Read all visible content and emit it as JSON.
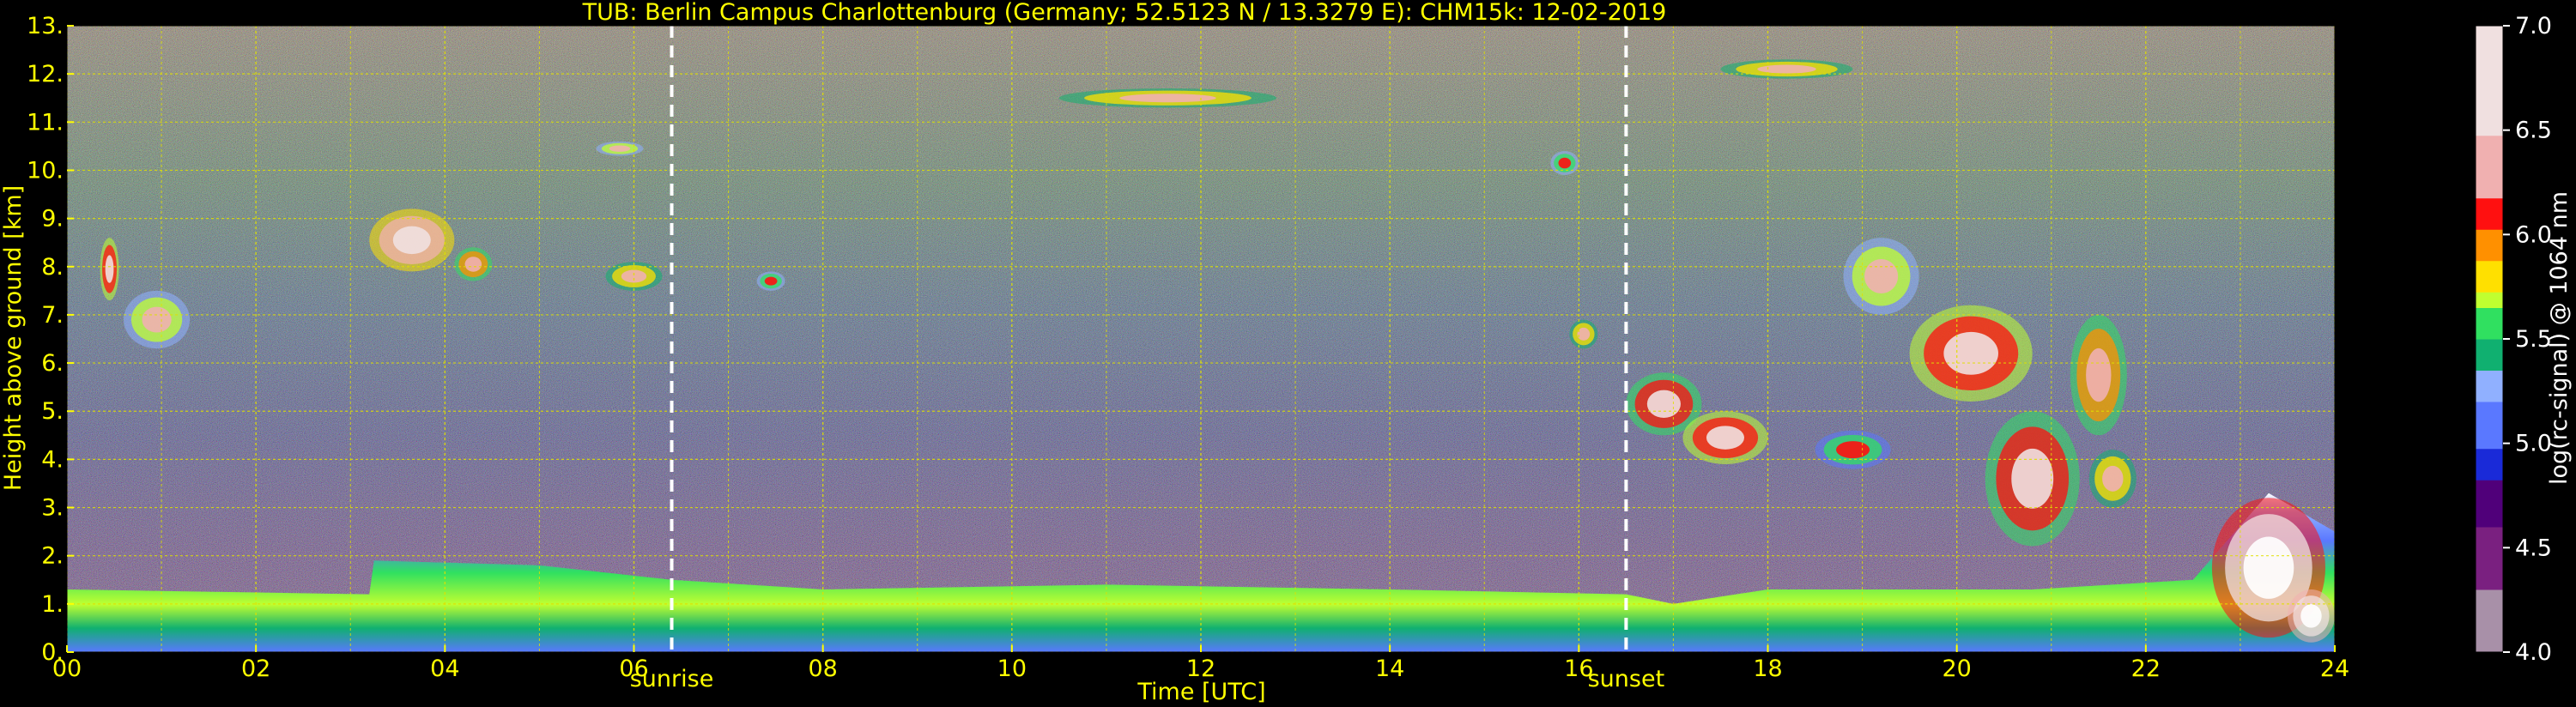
{
  "chart_data": {
    "type": "heatmap",
    "title": "TUB: Berlin Campus Charlottenburg (Germany; 52.5123 N / 13.3279 E):    CHM15k: 12-02-2019",
    "xlabel": "Time [UTC]",
    "ylabel": "Height above ground [km]",
    "colorbar_label": "log(rc-signal) @ 1064 nm",
    "xlim": [
      0,
      24
    ],
    "ylim": [
      0,
      13
    ],
    "clim": [
      4.0,
      7.0
    ],
    "x_ticks": [
      {
        "value": 0,
        "label": "00"
      },
      {
        "value": 2,
        "label": "02"
      },
      {
        "value": 4,
        "label": "04"
      },
      {
        "value": 6,
        "label": "06"
      },
      {
        "value": 8,
        "label": "08"
      },
      {
        "value": 10,
        "label": "10"
      },
      {
        "value": 12,
        "label": "12"
      },
      {
        "value": 14,
        "label": "14"
      },
      {
        "value": 16,
        "label": "16"
      },
      {
        "value": 18,
        "label": "18"
      },
      {
        "value": 20,
        "label": "20"
      },
      {
        "value": 22,
        "label": "22"
      },
      {
        "value": 24,
        "label": "24"
      }
    ],
    "y_ticks": [
      {
        "value": 0,
        "label": "0."
      },
      {
        "value": 1,
        "label": "1."
      },
      {
        "value": 2,
        "label": "2."
      },
      {
        "value": 3,
        "label": "3."
      },
      {
        "value": 4,
        "label": "4."
      },
      {
        "value": 5,
        "label": "5."
      },
      {
        "value": 6,
        "label": "6."
      },
      {
        "value": 7,
        "label": "7."
      },
      {
        "value": 8,
        "label": "8."
      },
      {
        "value": 9,
        "label": "9."
      },
      {
        "value": 10,
        "label": "10."
      },
      {
        "value": 11,
        "label": "11."
      },
      {
        "value": 12,
        "label": "12."
      },
      {
        "value": 13,
        "label": "13."
      }
    ],
    "colorbar_ticks": [
      {
        "value": 4.0,
        "label": "4.0"
      },
      {
        "value": 4.5,
        "label": "4.5"
      },
      {
        "value": 5.0,
        "label": "5.0"
      },
      {
        "value": 5.5,
        "label": "5.5"
      },
      {
        "value": 6.0,
        "label": "6.0"
      },
      {
        "value": 6.5,
        "label": "6.5"
      },
      {
        "value": 7.0,
        "label": "7.0"
      }
    ],
    "grid": true,
    "markers": [
      {
        "label": "sunrise",
        "time": 6.4
      },
      {
        "label": "sunset",
        "time": 16.5
      }
    ],
    "colorscale": [
      {
        "value": 4.0,
        "color": "#a890a8"
      },
      {
        "value": 4.3,
        "color": "#7a2080"
      },
      {
        "value": 4.6,
        "color": "#50007a"
      },
      {
        "value": 4.85,
        "color": "#1a2ad8"
      },
      {
        "value": 5.0,
        "color": "#5a78ff"
      },
      {
        "value": 5.2,
        "color": "#90b0ff"
      },
      {
        "value": 5.35,
        "color": "#10b070"
      },
      {
        "value": 5.5,
        "color": "#30e060"
      },
      {
        "value": 5.65,
        "color": "#c0ff30"
      },
      {
        "value": 5.75,
        "color": "#ffe000"
      },
      {
        "value": 5.85,
        "color": "#ff9000"
      },
      {
        "value": 6.0,
        "color": "#ff1010"
      },
      {
        "value": 6.2,
        "color": "#f0b0b0"
      },
      {
        "value": 6.45,
        "color": "#f0e0e0"
      },
      {
        "value": 7.0,
        "color": "#ffffff"
      }
    ],
    "boundary_layer_top_km": [
      [
        0,
        1.3
      ],
      [
        3.2,
        1.2
      ],
      [
        3.25,
        1.9
      ],
      [
        5,
        1.8
      ],
      [
        6.4,
        1.5
      ],
      [
        8,
        1.3
      ],
      [
        11,
        1.4
      ],
      [
        14,
        1.3
      ],
      [
        16.5,
        1.2
      ],
      [
        17,
        1.0
      ],
      [
        18,
        1.3
      ],
      [
        20.8,
        1.3
      ],
      [
        22.5,
        1.5
      ],
      [
        23.3,
        3.3
      ],
      [
        24,
        2.5
      ]
    ],
    "cloud_layers": [
      {
        "t0": 0.35,
        "t1": 0.55,
        "h0": 7.3,
        "h1": 8.6,
        "v": 6.3
      },
      {
        "t0": 0.6,
        "t1": 1.3,
        "h0": 6.3,
        "h1": 7.5,
        "v": 5.9
      },
      {
        "t0": 3.2,
        "t1": 4.1,
        "h0": 7.9,
        "h1": 9.2,
        "v": 6.4
      },
      {
        "t0": 4.1,
        "t1": 4.5,
        "h0": 7.7,
        "h1": 8.4,
        "v": 6.1
      },
      {
        "t0": 5.7,
        "t1": 6.3,
        "h0": 7.5,
        "h1": 8.1,
        "v": 6.0
      },
      {
        "t0": 7.3,
        "t1": 7.6,
        "h0": 7.5,
        "h1": 7.9,
        "v": 5.8
      },
      {
        "t0": 5.6,
        "t1": 6.1,
        "h0": 10.3,
        "h1": 10.6,
        "v": 5.9
      },
      {
        "t0": 10.5,
        "t1": 12.8,
        "h0": 11.3,
        "h1": 11.7,
        "v": 6.0
      },
      {
        "t0": 17.5,
        "t1": 18.9,
        "h0": 11.9,
        "h1": 12.3,
        "v": 6.0
      },
      {
        "t0": 15.7,
        "t1": 16.0,
        "h0": 9.9,
        "h1": 10.4,
        "v": 5.8
      },
      {
        "t0": 15.9,
        "t1": 16.2,
        "h0": 6.3,
        "h1": 6.9,
        "v": 6.0
      },
      {
        "t0": 16.5,
        "t1": 17.3,
        "h0": 4.5,
        "h1": 5.8,
        "v": 6.2
      },
      {
        "t0": 17.1,
        "t1": 18.0,
        "h0": 3.9,
        "h1": 5.0,
        "v": 6.3
      },
      {
        "t0": 18.5,
        "t1": 19.3,
        "h0": 3.8,
        "h1": 4.6,
        "v": 5.7
      },
      {
        "t0": 18.8,
        "t1": 19.6,
        "h0": 7.0,
        "h1": 8.6,
        "v": 5.9
      },
      {
        "t0": 19.5,
        "t1": 20.8,
        "h0": 5.2,
        "h1": 7.2,
        "v": 6.3
      },
      {
        "t0": 20.3,
        "t1": 21.3,
        "h0": 2.2,
        "h1": 5.0,
        "v": 6.2
      },
      {
        "t0": 21.2,
        "t1": 21.8,
        "h0": 4.5,
        "h1": 7.0,
        "v": 6.1
      },
      {
        "t0": 21.4,
        "t1": 21.9,
        "h0": 3.0,
        "h1": 4.2,
        "v": 6.0
      },
      {
        "t0": 22.7,
        "t1": 23.9,
        "h0": 0.3,
        "h1": 3.2,
        "v": 6.7
      },
      {
        "t0": 23.5,
        "t1": 24.0,
        "h0": 0.2,
        "h1": 1.3,
        "v": 6.9
      }
    ]
  }
}
